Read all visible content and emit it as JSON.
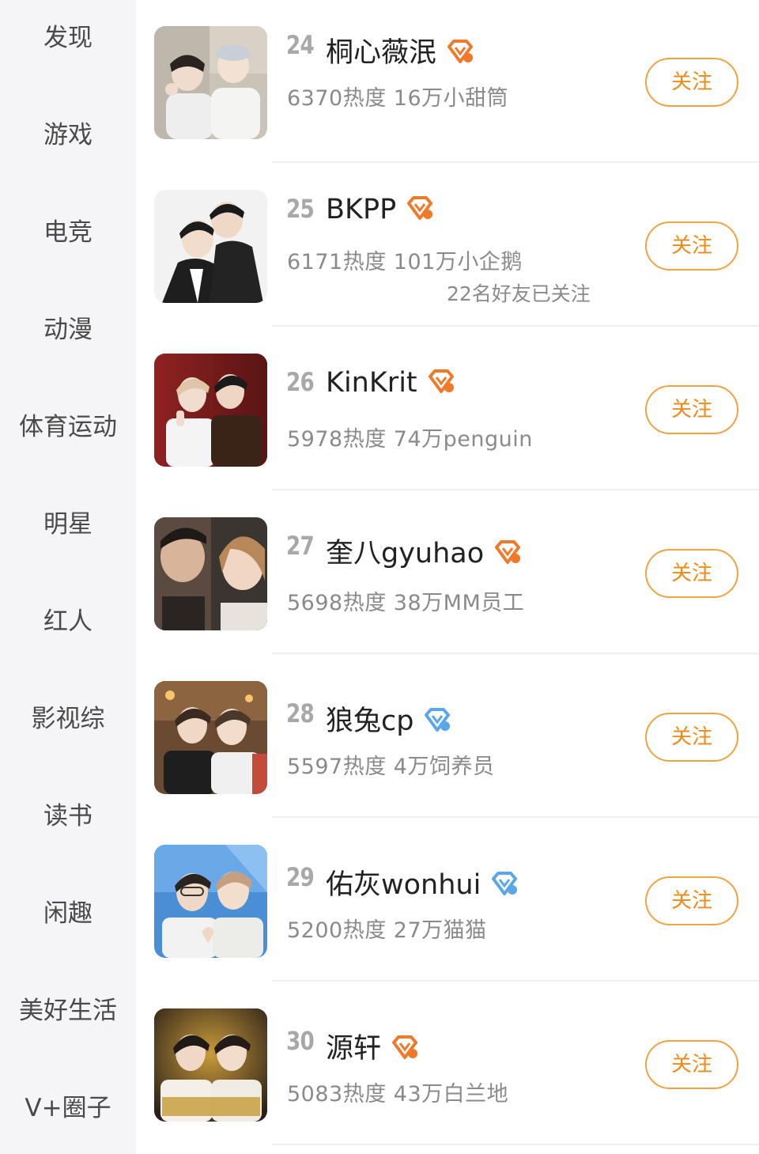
{
  "sidebar": {
    "items": [
      {
        "label": "发现"
      },
      {
        "label": "游戏"
      },
      {
        "label": "电竞"
      },
      {
        "label": "动漫"
      },
      {
        "label": "体育运动"
      },
      {
        "label": "明星"
      },
      {
        "label": "红人"
      },
      {
        "label": "影视综"
      },
      {
        "label": "读书"
      },
      {
        "label": "闲趣"
      },
      {
        "label": "美好生活"
      },
      {
        "label": "V+圈子"
      }
    ]
  },
  "list": {
    "rows": [
      {
        "rank": "24",
        "name": "桐心薇泯",
        "badge": "orange-diamond-icon",
        "stats": "6370热度 16万小甜筒",
        "friends": "",
        "follow_label": "关注"
      },
      {
        "rank": "25",
        "name": "BKPP",
        "badge": "orange-diamond-icon",
        "stats": "6171热度 101万小企鹅",
        "friends": "22名好友已关注",
        "follow_label": "关注"
      },
      {
        "rank": "26",
        "name": "KinKrit",
        "badge": "orange-diamond-icon",
        "stats": "5978热度 74万penguin",
        "friends": "",
        "follow_label": "关注"
      },
      {
        "rank": "27",
        "name": "奎八gyuhao",
        "badge": "orange-diamond-icon",
        "stats": "5698热度 38万MM员工",
        "friends": "",
        "follow_label": "关注"
      },
      {
        "rank": "28",
        "name": "狼兔cp",
        "badge": "blue-diamond-icon",
        "stats": "5597热度 4万饲养员",
        "friends": "",
        "follow_label": "关注"
      },
      {
        "rank": "29",
        "name": "佑灰wonhui",
        "badge": "blue-diamond-icon",
        "stats": "5200热度 27万猫猫",
        "friends": "",
        "follow_label": "关注"
      },
      {
        "rank": "30",
        "name": "源轩",
        "badge": "orange-diamond-icon",
        "stats": "5083热度 43万白兰地",
        "friends": "",
        "follow_label": "关注"
      }
    ]
  },
  "colors": {
    "accent": "#f08a17",
    "follow_border": "#f2a341",
    "badge_orange": "#f07a2a",
    "badge_blue": "#5aa6ea",
    "sidebar_bg": "#f5f5f7"
  }
}
